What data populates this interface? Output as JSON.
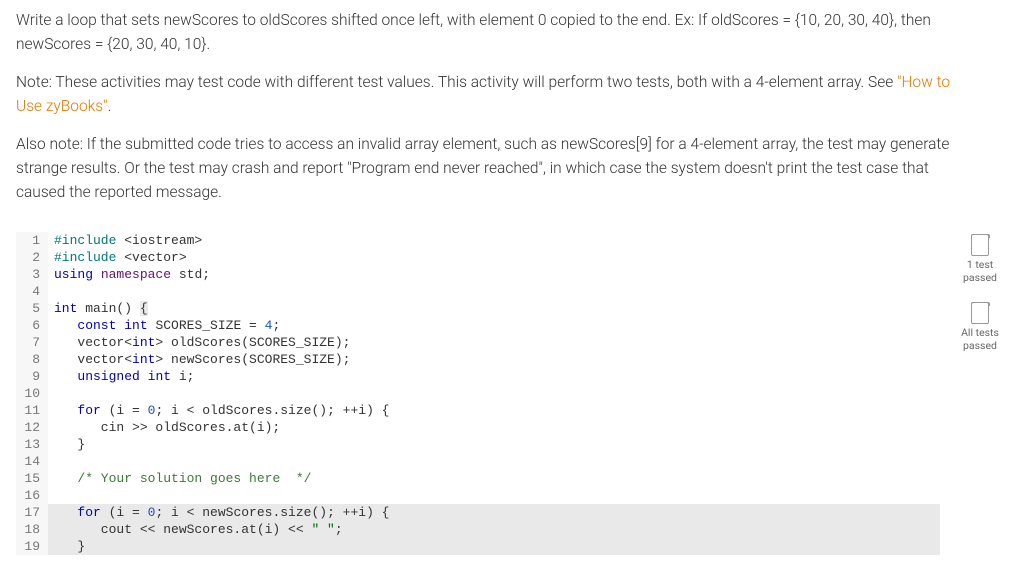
{
  "instructions": {
    "p1": "Write a loop that sets newScores to oldScores shifted once left, with element 0 copied to the end. Ex: If oldScores = {10, 20, 30, 40}, then newScores = {20, 30, 40, 10}.",
    "p2_prefix": "Note: These activities may test code with different test values. This activity will perform two tests, both with a 4-element array. See ",
    "p2_link": "\"How to Use zyBooks\"",
    "p2_suffix": ".",
    "p3": "Also note: If the submitted code tries to access an invalid array element, such as newScores[9] for a 4-element array, the test may generate strange results. Or the test may crash and report \"Program end never reached\", in which case the system doesn't print the test case that caused the reported message."
  },
  "status": {
    "item1_line1": "1 test",
    "item1_line2": "passed",
    "item2_line1": "All tests",
    "item2_line2": "passed"
  },
  "code": {
    "l1_a": "#include",
    "l1_b": " <iostream>",
    "l2_a": "#include",
    "l2_b": " <vector>",
    "l3_a": "using",
    "l3_b": " ",
    "l3_c": "namespace",
    "l3_d": " std;",
    "l4": "",
    "l5_a": "int",
    "l5_b": " main() ",
    "l5_c": "{",
    "l6_a": "   ",
    "l6_b": "const",
    "l6_c": " ",
    "l6_d": "int",
    "l6_e": " SCORES_SIZE = ",
    "l6_f": "4",
    "l6_g": ";",
    "l7_a": "   vector<",
    "l7_b": "int",
    "l7_c": "> oldScores(SCORES_SIZE);",
    "l8_a": "   vector<",
    "l8_b": "int",
    "l8_c": "> newScores(SCORES_SIZE);",
    "l9_a": "   ",
    "l9_b": "unsigned",
    "l9_c": " ",
    "l9_d": "int",
    "l9_e": " i;",
    "l10": "",
    "l11_a": "   ",
    "l11_b": "for",
    "l11_c": " (i = ",
    "l11_d": "0",
    "l11_e": "; i < oldScores.size(); ++i) {",
    "l12": "      cin >> oldScores.at(i);",
    "l13": "   }",
    "l14": "",
    "l15_a": "   ",
    "l15_b": "/* Your solution goes here  */",
    "l16": "",
    "l17_a": "   ",
    "l17_b": "for",
    "l17_c": " (i = ",
    "l17_d": "0",
    "l17_e": "; i < newScores.size(); ++i) {",
    "l18_a": "      cout << newScores.at(i) << ",
    "l18_b": "\" \"",
    "l18_c": ";",
    "l19": "   }"
  },
  "line_numbers": [
    "1",
    "2",
    "3",
    "4",
    "5",
    "6",
    "7",
    "8",
    "9",
    "10",
    "11",
    "12",
    "13",
    "14",
    "15",
    "16",
    "17",
    "18",
    "19"
  ]
}
